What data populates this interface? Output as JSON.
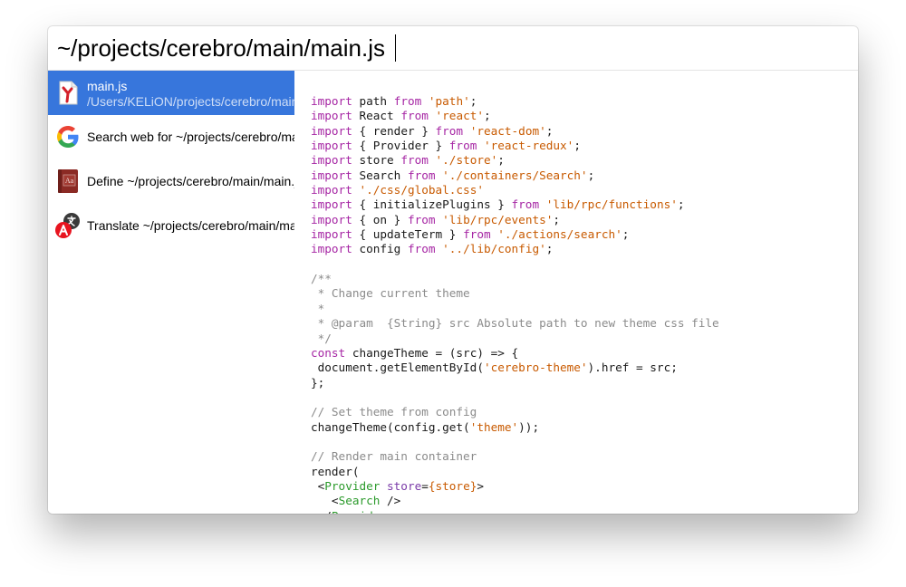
{
  "search": {
    "query": "~/projects/cerebro/main/main.js"
  },
  "results": [
    {
      "title": "main.js",
      "subtitle": "/Users/KELiON/projects/cerebro/main/main.js",
      "icon": "file-icon",
      "selected": true
    },
    {
      "title": "Search web for ~/projects/cerebro/main/main.js",
      "icon": "google-icon",
      "selected": false
    },
    {
      "title": "Define ~/projects/cerebro/main/main.js",
      "icon": "dictionary-icon",
      "selected": false
    },
    {
      "title": "Translate ~/projects/cerebro/main/main.js",
      "icon": "translate-icon",
      "selected": false
    }
  ],
  "preview": {
    "code_lines": [
      [
        [
          "kw",
          "import"
        ],
        [
          "",
          "  path "
        ],
        [
          "kw",
          "from"
        ],
        [
          "str",
          " 'path'"
        ],
        [
          "",
          ";"
        ]
      ],
      [
        [
          "kw",
          "import"
        ],
        [
          "",
          "  React "
        ],
        [
          "kw",
          "from"
        ],
        [
          "str",
          " 'react'"
        ],
        [
          "",
          ";"
        ]
      ],
      [
        [
          "kw",
          "import"
        ],
        [
          "",
          "  { render } "
        ],
        [
          "kw",
          "from"
        ],
        [
          "str",
          " 'react-dom'"
        ],
        [
          "",
          ";"
        ]
      ],
      [
        [
          "kw",
          "import"
        ],
        [
          "",
          "  { Provider } "
        ],
        [
          "kw",
          "from"
        ],
        [
          "str",
          " 'react-redux'"
        ],
        [
          "",
          ";"
        ]
      ],
      [
        [
          "kw",
          "import"
        ],
        [
          "",
          "  store "
        ],
        [
          "kw",
          "from"
        ],
        [
          "str",
          " './store'"
        ],
        [
          "",
          ";"
        ]
      ],
      [
        [
          "kw",
          "import"
        ],
        [
          "",
          "  Search "
        ],
        [
          "kw",
          "from"
        ],
        [
          "str",
          " './containers/Search'"
        ],
        [
          "",
          ";"
        ]
      ],
      [
        [
          "kw",
          "import"
        ],
        [
          "str",
          " './css/global.css'"
        ]
      ],
      [
        [
          "kw",
          "import"
        ],
        [
          "",
          "  { initializePlugins } "
        ],
        [
          "kw",
          "from"
        ],
        [
          "str",
          " 'lib/rpc/functions'"
        ],
        [
          "",
          ";"
        ]
      ],
      [
        [
          "kw",
          "import"
        ],
        [
          "",
          "  { on } "
        ],
        [
          "kw",
          "from"
        ],
        [
          "str",
          " 'lib/rpc/events'"
        ],
        [
          "",
          ";"
        ]
      ],
      [
        [
          "kw",
          "import"
        ],
        [
          "",
          "  { updateTerm } "
        ],
        [
          "kw",
          "from"
        ],
        [
          "str",
          " './actions/search'"
        ],
        [
          "",
          ";"
        ]
      ],
      [
        [
          "kw",
          "import"
        ],
        [
          "",
          "  config "
        ],
        [
          "kw",
          "from"
        ],
        [
          "str",
          " '../lib/config'"
        ],
        [
          "",
          ";"
        ]
      ],
      [],
      [
        [
          "cm",
          "/**"
        ]
      ],
      [
        [
          "cm",
          " * Change current theme"
        ]
      ],
      [
        [
          "cm",
          " *"
        ]
      ],
      [
        [
          "cm",
          " * @param  {String} src Absolute path to new theme css file"
        ]
      ],
      [
        [
          "cm",
          " */"
        ]
      ],
      [
        [
          "kw",
          "const"
        ],
        [
          "",
          " changeTheme = (src) => {"
        ]
      ],
      [
        [
          "",
          "  document.getElementById("
        ],
        [
          "str",
          "'cerebro-theme'"
        ],
        [
          "",
          ").href = src;"
        ]
      ],
      [
        [
          "",
          "};"
        ]
      ],
      [],
      [
        [
          "cm",
          "// Set theme from config"
        ]
      ],
      [
        [
          "",
          "changeTheme(config.get("
        ],
        [
          "str",
          "'theme'"
        ],
        [
          "",
          "));"
        ]
      ],
      [],
      [
        [
          "cm",
          "// Render main container"
        ]
      ],
      [
        [
          "",
          "render("
        ]
      ],
      [
        [
          "",
          "  <"
        ],
        [
          "tag",
          "Provider"
        ],
        [
          "attr",
          " store"
        ],
        [
          "",
          "="
        ],
        [
          "str",
          "{store}"
        ],
        [
          "",
          ">"
        ]
      ],
      [
        [
          "",
          "    <"
        ],
        [
          "tag",
          "Search"
        ],
        [
          "",
          " />"
        ]
      ],
      [
        [
          "",
          "  </"
        ],
        [
          "tag",
          "Provider"
        ],
        [
          "",
          ">"
        ]
      ]
    ]
  }
}
